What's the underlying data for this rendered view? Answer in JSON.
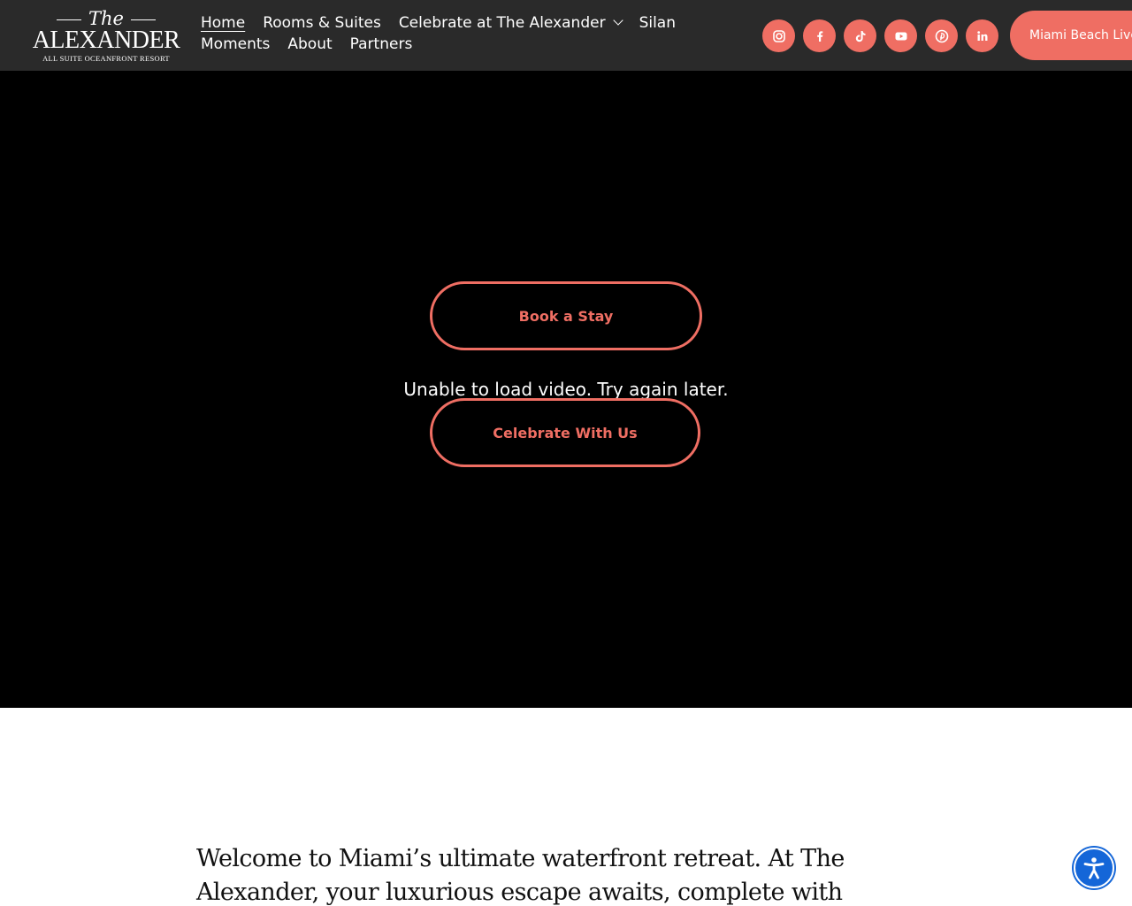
{
  "brand": {
    "logo_the": "The",
    "logo_name": "ALEXANDER",
    "logo_tagline": "ALL SUITE OCEANFRONT RESORT"
  },
  "nav": {
    "row1": [
      {
        "label": "Home",
        "active": true
      },
      {
        "label": "Rooms & Suites"
      },
      {
        "label": "Celebrate at The Alexander",
        "has_dropdown": true
      },
      {
        "label": "Silan"
      }
    ],
    "row2": [
      {
        "label": "Moments"
      },
      {
        "label": "About"
      },
      {
        "label": "Partners"
      }
    ]
  },
  "socials": [
    {
      "icon": "instagram-icon"
    },
    {
      "icon": "facebook-icon"
    },
    {
      "icon": "tiktok-icon"
    },
    {
      "icon": "youtube-icon"
    },
    {
      "icon": "pinterest-icon"
    },
    {
      "icon": "linkedin-icon"
    }
  ],
  "header_cta": {
    "label": "Miami Beach Live"
  },
  "hero": {
    "book_label": "Book a Stay",
    "celebrate_label": "Celebrate With Us",
    "video_error": "Unable to load video. Try again later."
  },
  "intro": {
    "text": "Welcome to Miami’s ultimate waterfront retreat. At The Alexander, your luxurious escape awaits, complete with breathtaking views and exclusive"
  },
  "colors": {
    "accent": "#ef6e63",
    "header_bg": "#2a2a2a",
    "hero_bg": "#000000",
    "accessibility": "#1466d8"
  },
  "accessibility": {
    "icon": "accessibility-icon"
  }
}
